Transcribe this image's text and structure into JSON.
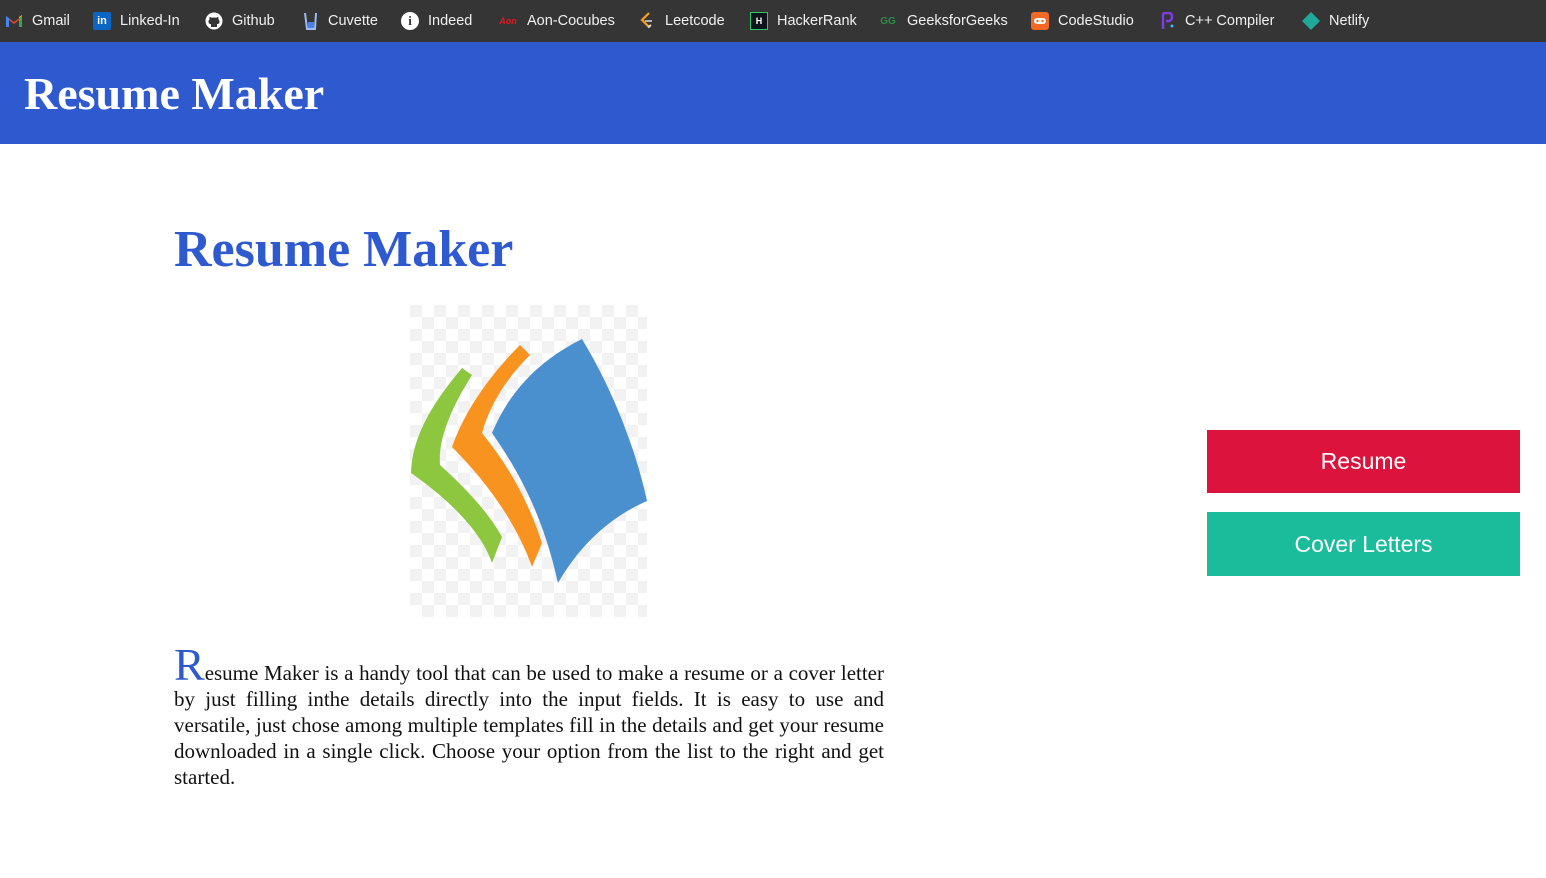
{
  "bookmarks": [
    {
      "label": "Gmail",
      "icon": "gmail-icon"
    },
    {
      "label": "Linked-In",
      "icon": "linkedin-icon"
    },
    {
      "label": "Github",
      "icon": "github-icon"
    },
    {
      "label": "Cuvette",
      "icon": "cuvette-icon"
    },
    {
      "label": "Indeed",
      "icon": "indeed-icon"
    },
    {
      "label": "Aon-Cocubes",
      "icon": "aon-icon"
    },
    {
      "label": "Leetcode",
      "icon": "leetcode-icon"
    },
    {
      "label": "HackerRank",
      "icon": "hackerrank-icon"
    },
    {
      "label": "GeeksforGeeks",
      "icon": "geeksforgeeks-icon"
    },
    {
      "label": "CodeStudio",
      "icon": "codestudio-icon"
    },
    {
      "label": "C++ Compiler",
      "icon": "cpp-compiler-icon"
    },
    {
      "label": "Netlify",
      "icon": "netlify-icon"
    }
  ],
  "header": {
    "title": "Resume Maker"
  },
  "main": {
    "heading": "Resume Maker",
    "logo_icon": "resume-maker-logo",
    "description_first_letter": "R",
    "description_rest": "esume Maker is a handy tool that can be used to make a resume or a cover letter by just filling inthe details directly into the input fields. It is easy to use and versatile, just chose among multiple templates fill in the details and get your resume downloaded in a single click. Choose your option from the list to the right and get started."
  },
  "actions": {
    "resume_label": "Resume",
    "cover_letters_label": "Cover Letters"
  },
  "colors": {
    "header_bg": "#2f5acf",
    "resume_button": "#dc133c",
    "cover_button": "#1abc9c",
    "bookmark_bar": "#353535"
  }
}
